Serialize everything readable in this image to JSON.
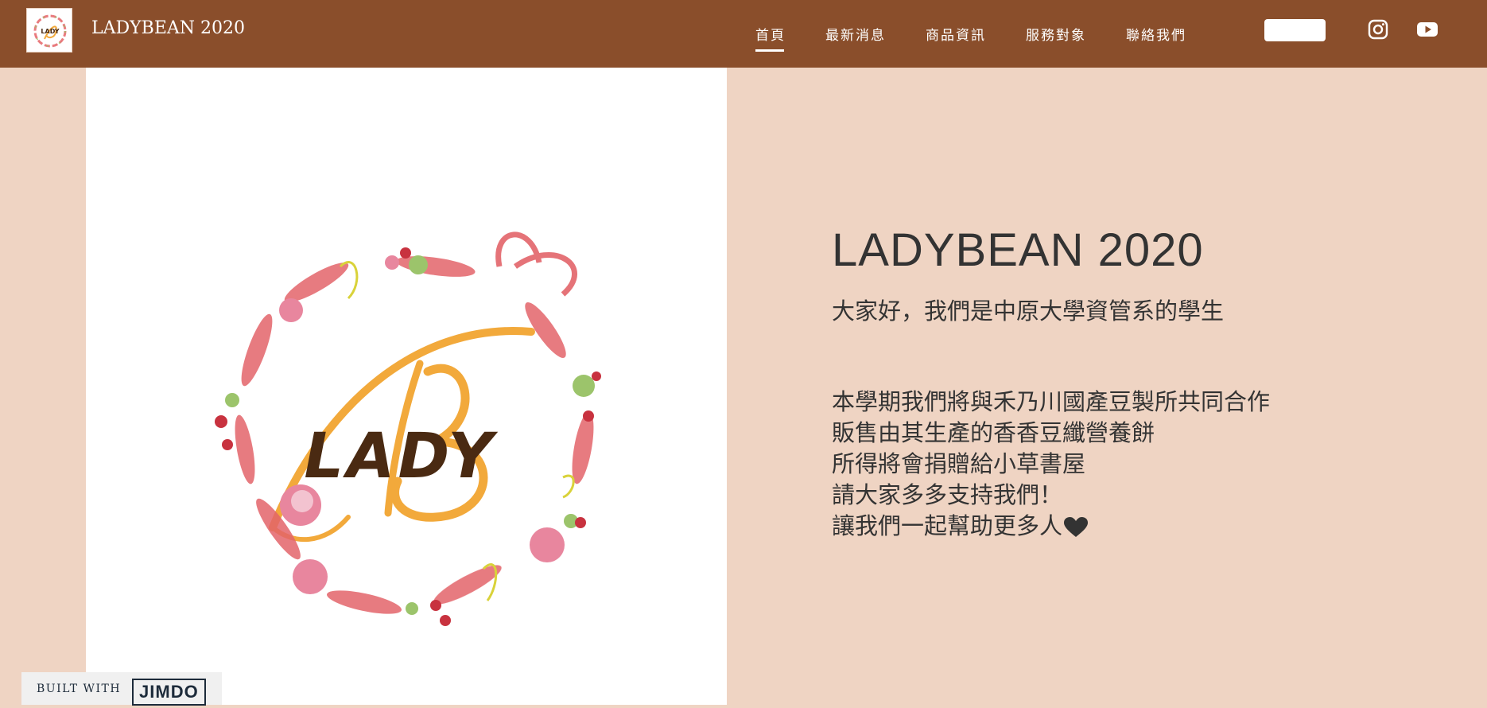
{
  "header": {
    "site_title": "LADYBEAN 2020",
    "nav": [
      {
        "label": "首頁",
        "active": true
      },
      {
        "label": "最新消息",
        "active": false
      },
      {
        "label": "商品資訊",
        "active": false
      },
      {
        "label": "服務對象",
        "active": false
      },
      {
        "label": "聯絡我們",
        "active": false
      }
    ],
    "social": [
      "instagram-icon",
      "youtube-icon"
    ]
  },
  "hero": {
    "logo_text": "LADY",
    "title": "LADYBEAN 2020",
    "intro": "大家好，我們是中原大學資管系的學生",
    "body_lines": [
      "本學期我們將與禾乃川國產豆製所共同合作",
      "販售由其生產的香香豆纖營養餅",
      "所得將會捐贈給小草書屋",
      "請大家多多支持我們！",
      "讓我們一起幫助更多人"
    ]
  },
  "footer_badge": {
    "built_with": "BUILT WITH",
    "brand": "JIMDO"
  },
  "colors": {
    "header_bg": "#8a4e2b",
    "page_bg": "#efd4c3",
    "text": "#333333",
    "logo_gold": "#f2a93b",
    "logo_brown": "#4a2a12",
    "wreath_pink": "#e3646a"
  }
}
